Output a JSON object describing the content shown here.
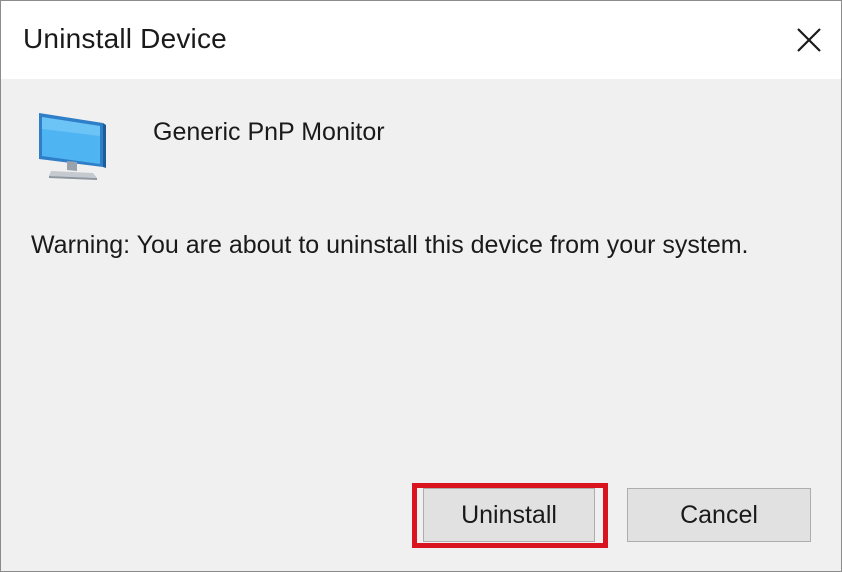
{
  "window": {
    "title": "Uninstall Device",
    "close_icon": "close-icon"
  },
  "device": {
    "icon": "monitor-icon",
    "name": "Generic PnP Monitor"
  },
  "message": {
    "warning": "Warning: You are about to uninstall this device from your system."
  },
  "buttons": {
    "uninstall_label": "Uninstall",
    "cancel_label": "Cancel"
  },
  "colors": {
    "highlight": "#d9141e",
    "dialog_background": "#f0f0f0",
    "button_background": "#e1e1e1"
  }
}
